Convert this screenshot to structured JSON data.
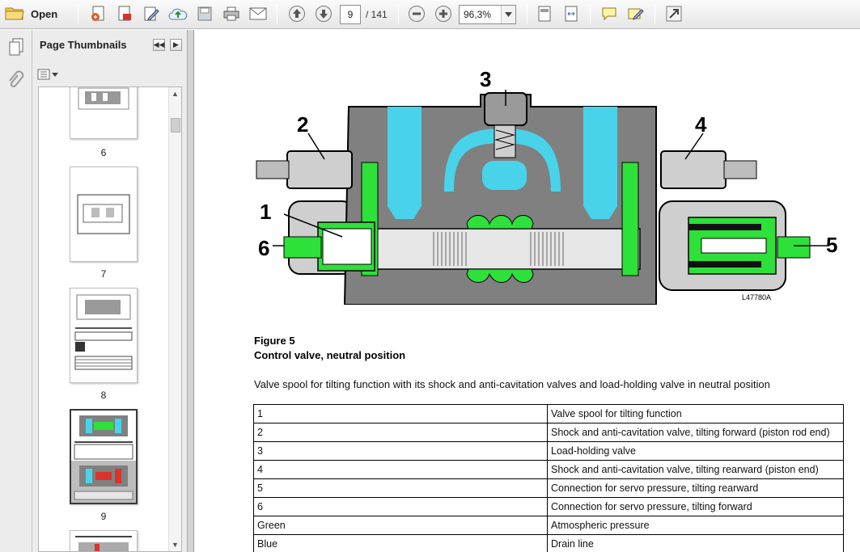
{
  "toolbar": {
    "open_label": "Open",
    "current_page": "9",
    "page_of": "/ 141",
    "zoom": "96,3%"
  },
  "thumbnails": {
    "title": "Page Thumbnails",
    "pages": [
      {
        "label": "6"
      },
      {
        "label": "7"
      },
      {
        "label": "8"
      },
      {
        "label": "9",
        "selected": true
      }
    ]
  },
  "document": {
    "figure": {
      "callouts": [
        "1",
        "2",
        "3",
        "4",
        "5",
        "6"
      ],
      "image_code": "L47780A",
      "colors": {
        "green": "#2ee03a",
        "blue": "#49d3ea",
        "gray": "#7f7f7f"
      }
    },
    "figure_label": "Figure 5",
    "figure_title": "Control valve, neutral position",
    "description": "Valve spool for tilting function with its shock and anti-cavitation valves and load-holding valve in neutral position",
    "legend": [
      {
        "key": "1",
        "value": "Valve spool for tilting function"
      },
      {
        "key": "2",
        "value": "Shock and anti-cavitation valve, tilting forward (piston rod end)"
      },
      {
        "key": "3",
        "value": "Load-holding valve"
      },
      {
        "key": "4",
        "value": "Shock and anti-cavitation valve, tilting rearward (piston end)"
      },
      {
        "key": "5",
        "value": "Connection for servo pressure, tilting rearward"
      },
      {
        "key": "6",
        "value": "Connection for servo pressure, tilting forward"
      },
      {
        "key": "Green",
        "value": "Atmospheric pressure"
      },
      {
        "key": "Blue",
        "value": "Drain line"
      }
    ]
  }
}
